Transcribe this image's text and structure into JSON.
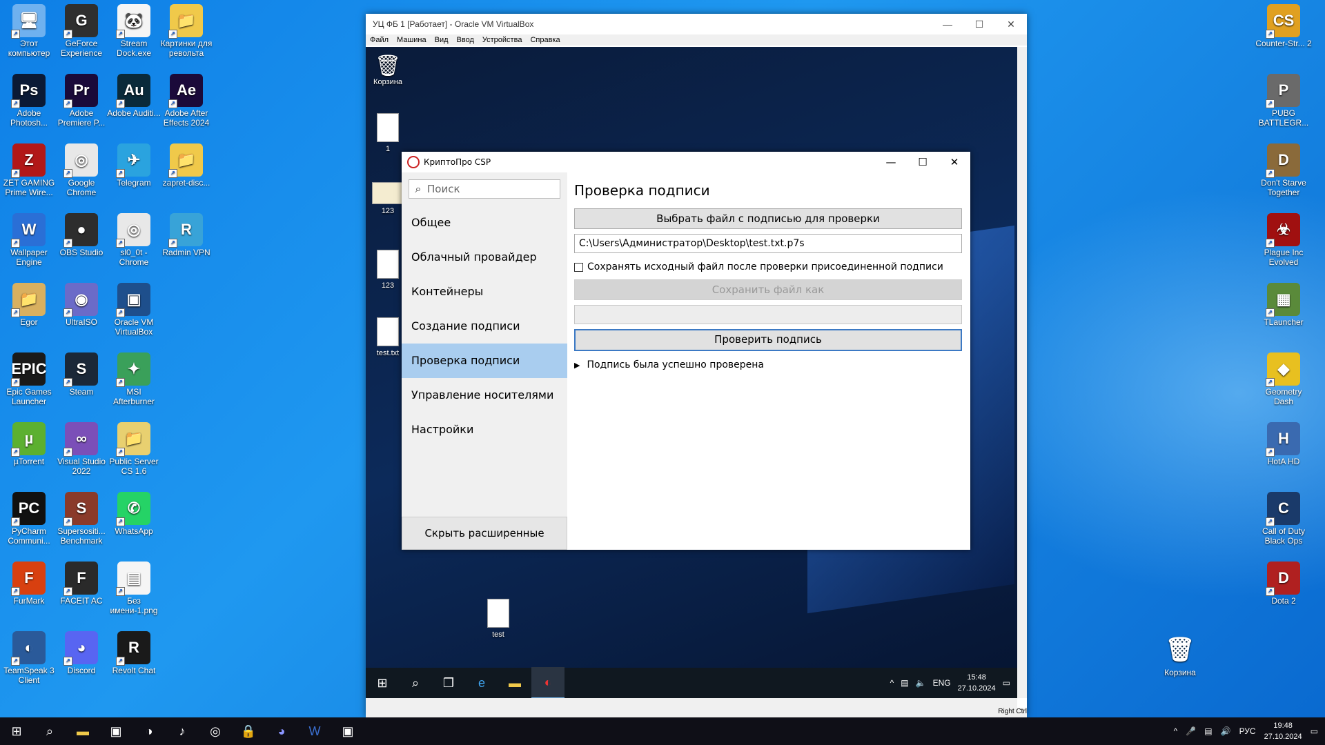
{
  "desktop_left": [
    {
      "label": "Этот компьютер",
      "color": "#6fb1ef",
      "glyph": "🖥"
    },
    {
      "label": "GeForce Experience",
      "color": "#2f2f2f",
      "glyph": "G"
    },
    {
      "label": "Stream Dock.exe",
      "color": "#f5f5f5",
      "glyph": "🐼"
    },
    {
      "label": "Картинки для револьта",
      "color": "#f0c94a",
      "glyph": "📁"
    },
    {
      "label": "Adobe Photosh...",
      "color": "#0b1a36",
      "glyph": "Ps"
    },
    {
      "label": "Adobe Premiere P...",
      "color": "#1a0a3a",
      "glyph": "Pr"
    },
    {
      "label": "Adobe Auditi...",
      "color": "#0a2a3a",
      "glyph": "Au"
    },
    {
      "label": "Adobe After Effects 2024",
      "color": "#1b0a3a",
      "glyph": "Ae"
    },
    {
      "label": "ZET GAMING Prime Wire...",
      "color": "#b21818",
      "glyph": "Z"
    },
    {
      "label": "Google Chrome",
      "color": "#e8e8e8",
      "glyph": "◎"
    },
    {
      "label": "Telegram",
      "color": "#2aa3df",
      "glyph": "✈"
    },
    {
      "label": "zapret-disc...",
      "color": "#f0c94a",
      "glyph": "📁"
    },
    {
      "label": "Wallpaper Engine",
      "color": "#2a6fd6",
      "glyph": "W"
    },
    {
      "label": "OBS Studio",
      "color": "#2d2d2d",
      "glyph": "●"
    },
    {
      "label": "sl0_0t - Chrome",
      "color": "#e8e8e8",
      "glyph": "◎"
    },
    {
      "label": "Radmin VPN",
      "color": "#38a3d8",
      "glyph": "R"
    },
    {
      "label": "Egor",
      "color": "#d8b060",
      "glyph": "📁"
    },
    {
      "label": "UltraISO",
      "color": "#6b6bc8",
      "glyph": "◉"
    },
    {
      "label": "Oracle VM VirtualBox",
      "color": "#1e4f8c",
      "glyph": "▣"
    },
    {
      "label": "",
      "color": "",
      "glyph": ""
    },
    {
      "label": "Epic Games Launcher",
      "color": "#1a1a1a",
      "glyph": "EPIC"
    },
    {
      "label": "Steam",
      "color": "#1b2838",
      "glyph": "S"
    },
    {
      "label": "MSI Afterburner",
      "color": "#3aa05a",
      "glyph": "✦"
    },
    {
      "label": "",
      "color": "",
      "glyph": ""
    },
    {
      "label": "µTorrent",
      "color": "#5cb030",
      "glyph": "µ"
    },
    {
      "label": "Visual Studio 2022",
      "color": "#7b4fb8",
      "glyph": "∞"
    },
    {
      "label": "Public Server CS 1.6",
      "color": "#e8d070",
      "glyph": "📁"
    },
    {
      "label": "",
      "color": "",
      "glyph": ""
    },
    {
      "label": "PyCharm Communi...",
      "color": "#111111",
      "glyph": "PC"
    },
    {
      "label": "Supersositi... Benchmark",
      "color": "#8a3a2a",
      "glyph": "S"
    },
    {
      "label": "WhatsApp",
      "color": "#25d366",
      "glyph": "✆"
    },
    {
      "label": "",
      "color": "",
      "glyph": ""
    },
    {
      "label": "FurMark",
      "color": "#d84010",
      "glyph": "F"
    },
    {
      "label": "FACEIT AC",
      "color": "#2a2a2a",
      "glyph": "F"
    },
    {
      "label": "Без имени-1.png",
      "color": "#f5f5f5",
      "glyph": "▤"
    },
    {
      "label": "",
      "color": "",
      "glyph": ""
    },
    {
      "label": "TeamSpeak 3 Client",
      "color": "#2a5a9a",
      "glyph": "◐"
    },
    {
      "label": "Discord",
      "color": "#5865f2",
      "glyph": "◕"
    },
    {
      "label": "Revolt Chat",
      "color": "#1a1a1a",
      "glyph": "R"
    }
  ],
  "desktop_right": [
    {
      "label": "Counter-Str... 2",
      "color": "#e0a020",
      "glyph": "CS"
    },
    {
      "label": "PUBG BATTLEGR...",
      "color": "#6a6a6a",
      "glyph": "P"
    },
    {
      "label": "Don't Starve Together",
      "color": "#8a6a3a",
      "glyph": "D"
    },
    {
      "label": "Plague Inc Evolved",
      "color": "#a01010",
      "glyph": "☣"
    },
    {
      "label": "TLauncher",
      "color": "#5a8a3a",
      "glyph": "▦"
    },
    {
      "label": "Geometry Dash",
      "color": "#e8c020",
      "glyph": "◆"
    },
    {
      "label": "HotA HD",
      "color": "#3a6ab0",
      "glyph": "H"
    },
    {
      "label": "Call of Duty Black Ops",
      "color": "#1a3a6a",
      "glyph": "C"
    },
    {
      "label": "Dota 2",
      "color": "#b02020",
      "glyph": "D"
    }
  ],
  "desktop_recycle": "Корзина",
  "vbox": {
    "title": "УЦ ФБ 1 [Работает] - Oracle VM VirtualBox",
    "menu": [
      "Файл",
      "Машина",
      "Вид",
      "Ввод",
      "Устройства",
      "Справка"
    ],
    "status_right": "Right Ctrl"
  },
  "guest": {
    "icons": [
      "Корзина",
      "1",
      "123",
      "123",
      "test.txt",
      "test"
    ],
    "tray_lang": "ENG",
    "time": "15:48",
    "date": "27.10.2024"
  },
  "dialog": {
    "title": "КриптоПро CSP",
    "search_placeholder": "Поиск",
    "nav": [
      "Общее",
      "Облачный провайдер",
      "Контейнеры",
      "Создание подписи",
      "Проверка подписи",
      "Управление носителями",
      "Настройки"
    ],
    "hide_button": "Скрыть расширенные",
    "heading": "Проверка подписи",
    "choose_button": "Выбрать файл с подписью для проверки",
    "file_path": "C:\\Users\\Администратор\\Desktop\\test.txt.p7s",
    "keep_checkbox": "Сохранять исходный файл после проверки присоединенной подписи",
    "save_as_button": "Сохранить файл как",
    "verify_button": "Проверить подпись",
    "result": "Подпись была успешно проверена"
  },
  "host_taskbar": {
    "lang": "РУС",
    "time": "19:48",
    "date": "27.10.2024"
  }
}
